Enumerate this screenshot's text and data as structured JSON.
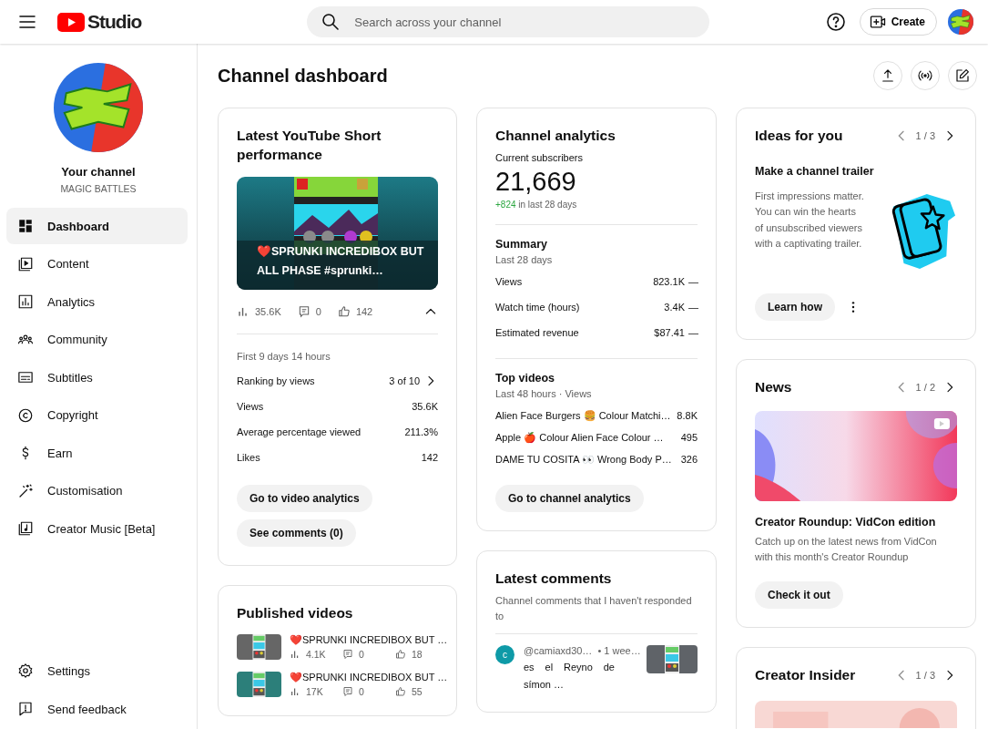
{
  "header": {
    "logo_text": "Studio",
    "search": {
      "placeholder": "Search across your channel"
    },
    "create_label": "Create"
  },
  "sidebar": {
    "channel": {
      "label": "Your channel",
      "name": "MAGIC BATTLES"
    },
    "items": [
      {
        "label": "Dashboard",
        "selected": true
      },
      {
        "label": "Content",
        "selected": false
      },
      {
        "label": "Analytics",
        "selected": false
      },
      {
        "label": "Community",
        "selected": false
      },
      {
        "label": "Subtitles",
        "selected": false
      },
      {
        "label": "Copyright",
        "selected": false
      },
      {
        "label": "Earn",
        "selected": false
      },
      {
        "label": "Customisation",
        "selected": false
      },
      {
        "label": "Creator Music [Beta]",
        "selected": false
      }
    ],
    "footer_items": [
      {
        "label": "Settings"
      },
      {
        "label": "Send feedback"
      }
    ]
  },
  "page_title": "Channel dashboard",
  "short_card": {
    "title": "Latest YouTube Short performance",
    "video_title": "❤️SPRUNKI INCREDIBOX BUT ALL PHASE #sprunki…",
    "stats": {
      "views": "35.6K",
      "comments": "0",
      "likes": "142"
    },
    "expanded": true,
    "period": "First 9 days 14 hours",
    "ranking": {
      "label": "Ranking by views",
      "value": "3 of 10"
    },
    "metrics": [
      {
        "label": "Views",
        "value": "35.6K"
      },
      {
        "label": "Average percentage viewed",
        "value": "211.3%"
      },
      {
        "label": "Likes",
        "value": "142"
      }
    ],
    "buttons": [
      "Go to video analytics",
      "See comments (0)"
    ]
  },
  "published_card": {
    "title": "Published videos",
    "videos": [
      {
        "title": "❤️SPRUNKI INCREDIBOX BUT …",
        "views": "4.1K",
        "comments": "0",
        "likes": "18"
      },
      {
        "title": "❤️SPRUNKI INCREDIBOX BUT …",
        "views": "17K",
        "comments": "0",
        "likes": "55"
      }
    ]
  },
  "analytics_card": {
    "title": "Channel analytics",
    "subscribers_label": "Current subscribers",
    "subscribers": "21,669",
    "change": "+824",
    "change_suffix": "in last 28 days",
    "summary": {
      "title": "Summary",
      "period": "Last 28 days",
      "rows": [
        {
          "label": "Views",
          "value": "823.1K",
          "trend": "—"
        },
        {
          "label": "Watch time (hours)",
          "value": "3.4K",
          "trend": "—"
        },
        {
          "label": "Estimated revenue",
          "value": "$87.41",
          "trend": "—"
        }
      ]
    },
    "top_videos": {
      "title": "Top videos",
      "period": "Last 48 hours · Views",
      "rows": [
        {
          "title": "Alien Face Burgers 🍔 Colour Matchi…",
          "views": "8.8K"
        },
        {
          "title": "Apple 🍎 Colour Alien Face Colour …",
          "views": "495"
        },
        {
          "title": "DAME TU COSITA 👀 Wrong Body P…",
          "views": "326"
        }
      ]
    },
    "button": "Go to channel analytics"
  },
  "comments_card": {
    "title": "Latest comments",
    "subtitle": "Channel comments that I haven't responded to",
    "comments": [
      {
        "initial": "c",
        "color": "#0e9aa7",
        "author": "@camiaxd30…",
        "time": "• 1 wee…",
        "text": "es el Reyno de símon …"
      }
    ]
  },
  "ideas_card": {
    "title": "Ideas for you",
    "pager": "1 / 3",
    "idea_title": "Make a channel trailer",
    "text": "First impressions matter. You can win the hearts of unsubscribed viewers with a captivating trailer.",
    "button": "Learn how"
  },
  "news_card": {
    "title": "News",
    "pager": "1 / 2",
    "article_title": "Creator Roundup: VidCon edition",
    "text": "Catch up on the latest news from VidCon with this month's Creator Roundup",
    "button": "Check it out"
  },
  "insider_card": {
    "title": "Creator Insider",
    "pager": "1 / 3"
  }
}
